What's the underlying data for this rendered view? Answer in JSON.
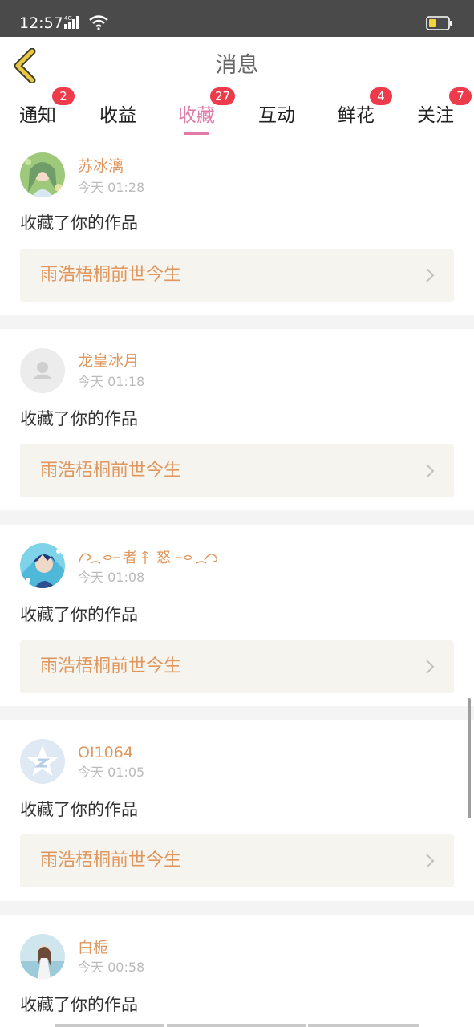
{
  "status_bar": {
    "time": "12:57",
    "network": "4G",
    "signal_icon": "signal-bars-icon",
    "wifi_icon": "wifi-icon",
    "battery_icon": "battery-low-icon",
    "battery_level": 0.3
  },
  "header": {
    "back_icon": "chevron-left-icon",
    "title": "消息"
  },
  "tabs": [
    {
      "label": "通知",
      "badge": "2",
      "active": false
    },
    {
      "label": "收益",
      "badge": "",
      "active": false
    },
    {
      "label": "收藏",
      "badge": "27",
      "active": true
    },
    {
      "label": "互动",
      "badge": "",
      "active": false
    },
    {
      "label": "鲜花",
      "badge": "4",
      "active": false
    },
    {
      "label": "关注",
      "badge": "7",
      "active": false
    }
  ],
  "notifications": [
    {
      "user": "苏冰漓",
      "time": "今天 01:28",
      "action": "收藏了你的作品",
      "work": "雨浩梧桐前世今生",
      "avatar_icon": "anime-girl-avatar-icon"
    },
    {
      "user": "龙皇冰月",
      "time": "今天 01:18",
      "action": "收藏了你的作品",
      "work": "雨浩梧桐前世今生",
      "avatar_icon": "default-user-avatar-icon"
    },
    {
      "user": "者",
      "user_suffix": "怒",
      "time": "今天 01:08",
      "action": "收藏了你的作品",
      "work": "雨浩梧桐前世今生",
      "avatar_icon": "anime-boy-avatar-icon"
    },
    {
      "user": "OI1064",
      "time": "今天 01:05",
      "action": "收藏了你的作品",
      "work": "雨浩梧桐前世今生",
      "avatar_icon": "star-logo-avatar-icon"
    },
    {
      "user": "白栀",
      "time": "今天 00:58",
      "action": "收藏了你的作品",
      "work": "",
      "avatar_icon": "photo-girl-avatar-icon"
    }
  ],
  "colors": {
    "accent_pink": "#e07aa8",
    "username_orange": "#e0965c",
    "badge_red": "#ee3b4c",
    "work_card_bg": "#f5f4ee",
    "back_arrow_yellow": "#e8c840"
  }
}
